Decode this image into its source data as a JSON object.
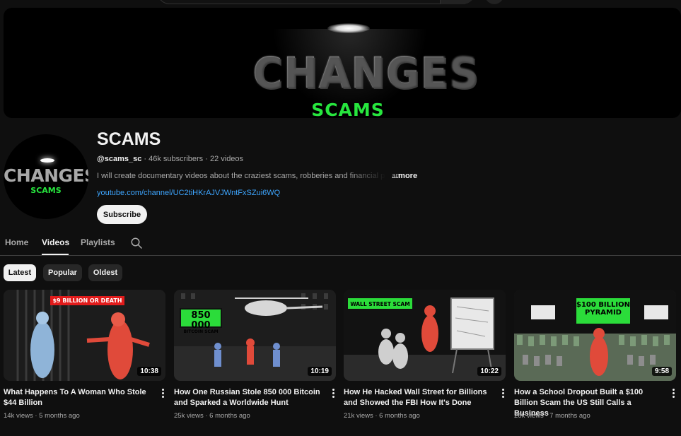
{
  "channel": {
    "banner_title": "CHANGES",
    "banner_subtitle": "SCAMS",
    "avatar_title": "CHANGES",
    "avatar_subtitle": "SCAMS",
    "name": "SCAMS",
    "handle": "@scams_sc",
    "subscribers": "46k subscribers",
    "videos_count": "22 videos",
    "separator": " · ",
    "description": "I will create documentary videos about the craziest scams, robberies and financial pyramids",
    "more_label": "...more",
    "link": "youtube.com/channel/UC2tiHKrAJVJWntFxSZui6WQ",
    "subscribe_label": "Subscribe"
  },
  "tabs": [
    {
      "label": "Home"
    },
    {
      "label": "Videos"
    },
    {
      "label": "Playlists"
    }
  ],
  "filters": [
    {
      "label": "Latest"
    },
    {
      "label": "Popular"
    },
    {
      "label": "Oldest"
    }
  ],
  "videos": [
    {
      "title": "What Happens To A Woman Who Stole $44 Billion",
      "views": "14k views",
      "age": "5 months ago",
      "duration": "10:38",
      "thumb_text": "$9 BILLION OR DEATH"
    },
    {
      "title": "How One Russian Stole 850 000 Bitcoin and Sparked a Worldwide Hunt",
      "views": "25k views",
      "age": "6 months ago",
      "duration": "10:19",
      "thumb_text": "850 000",
      "thumb_subtext": "BITCOIN SCAM"
    },
    {
      "title": "How He Hacked Wall Street for Billions and Showed the FBI How It's Done",
      "views": "21k views",
      "age": "6 months ago",
      "duration": "10:22",
      "thumb_text": "WALL STREET SCAM"
    },
    {
      "title": "How a School Dropout Built a $100 Billion Scam the US Still Calls a Business",
      "views": "26k views",
      "age": "7 months ago",
      "duration": "9:58",
      "thumb_text": "$100 BILLION",
      "thumb_subtext": "PYRAMID"
    }
  ],
  "colors": {
    "background": "#0f0f0f",
    "link": "#3ea6ff",
    "brand_green": "#27e63e",
    "tag_red": "#e21b1b"
  },
  "icons": [
    "search-icon",
    "more-vert-icon"
  ]
}
